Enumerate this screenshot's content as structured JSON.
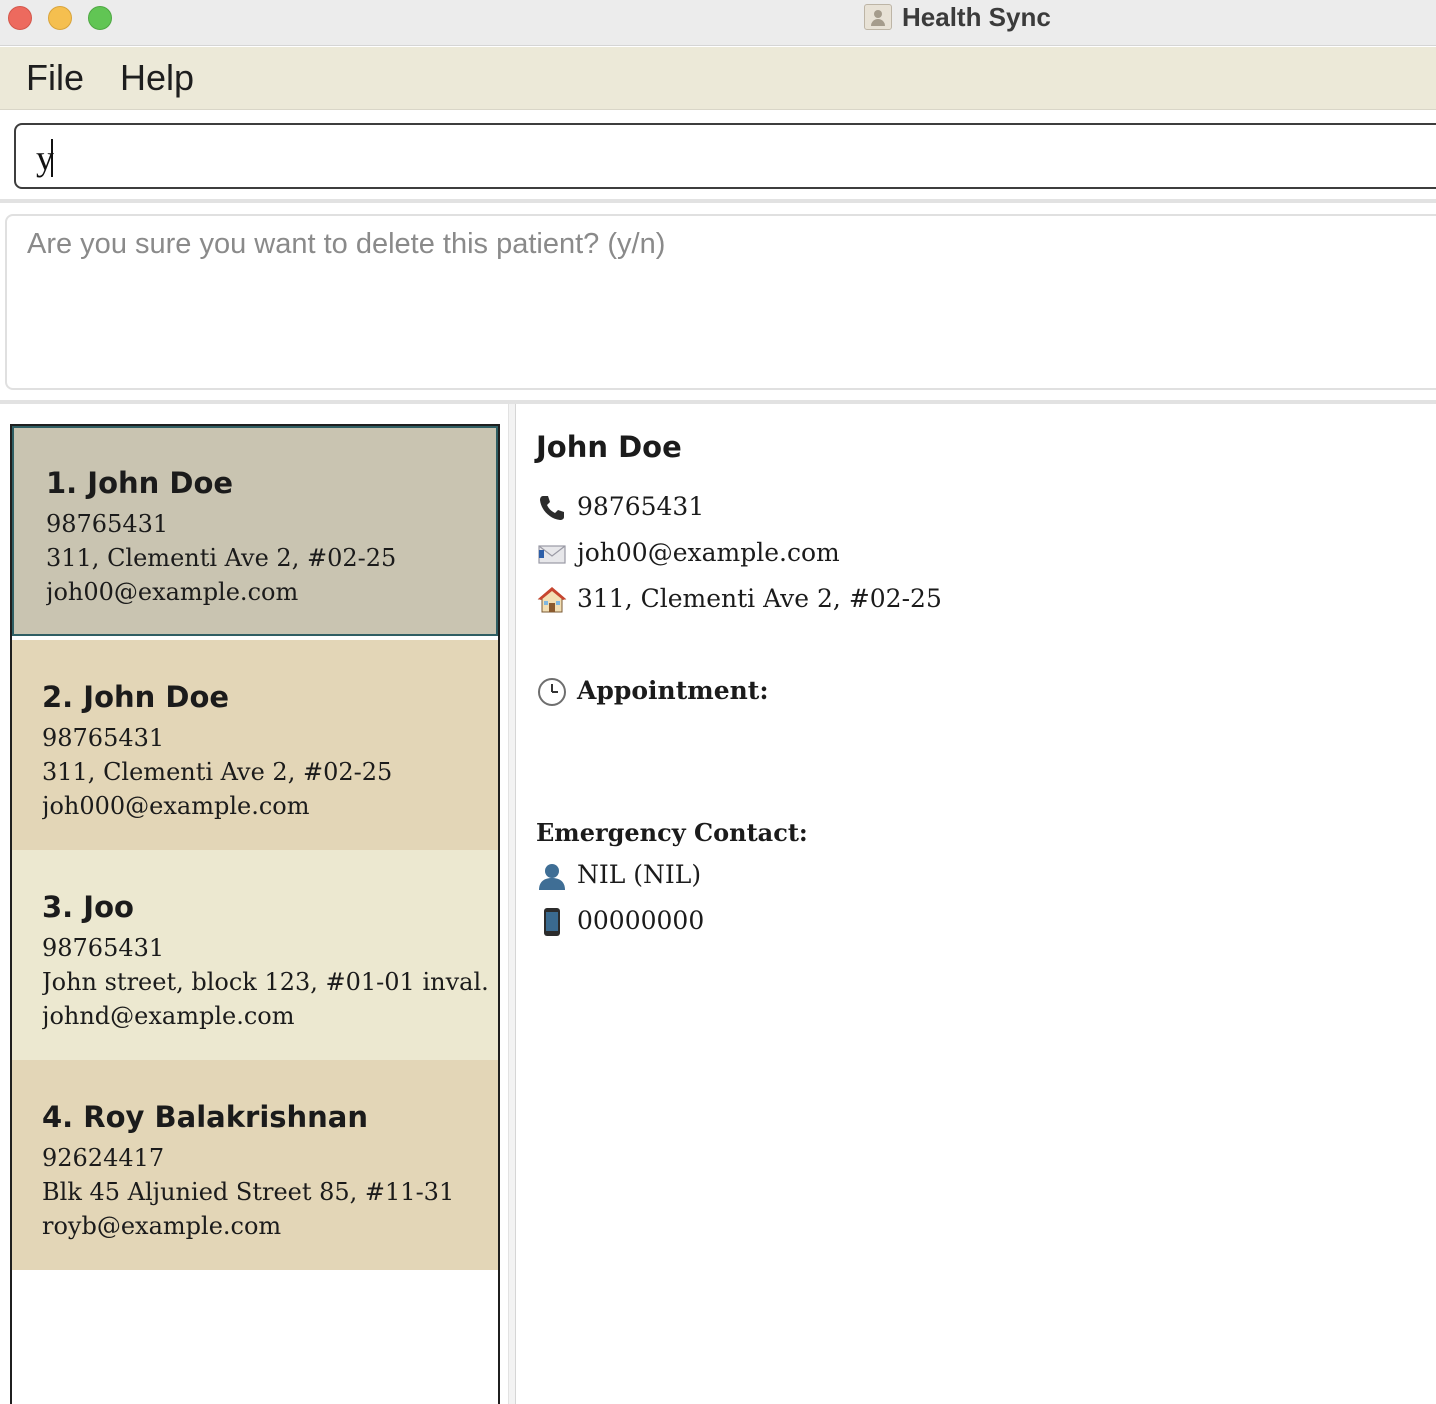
{
  "window": {
    "title": "Health Sync"
  },
  "menu": {
    "file": "File",
    "help": "Help"
  },
  "command": {
    "value": "y"
  },
  "result": {
    "text": "Are you sure you want to delete this patient? (y/n)"
  },
  "patients": [
    {
      "name": "1. John Doe",
      "phone": "98765431",
      "address": "311, Clementi Ave 2, #02-25",
      "email": "joh00@example.com",
      "selected": true
    },
    {
      "name": "2. John Doe",
      "phone": "98765431",
      "address": "311, Clementi Ave 2, #02-25",
      "email": "joh000@example.com"
    },
    {
      "name": "3. Joo",
      "phone": "98765431",
      "address": "John street, block 123, #01-01 inval...",
      "email": "johnd@example.com"
    },
    {
      "name": "4. Roy Balakrishnan",
      "phone": "92624417",
      "address": "Blk 45 Aljunied Street 85, #11-31",
      "email": "royb@example.com"
    }
  ],
  "detail": {
    "name": "John Doe",
    "phone": "98765431",
    "email": "joh00@example.com",
    "address": "311, Clementi Ave 2, #02-25",
    "appointment_label": "Appointment:",
    "emergency_label": "Emergency Contact:",
    "emergency_name": "NIL  (NIL)",
    "emergency_phone": "00000000"
  },
  "icons": {
    "phone": "phone-icon",
    "email": "email-icon",
    "address": "house-icon",
    "appointment": "clock-icon",
    "contact": "person-icon",
    "mobile": "mobile-phone-icon"
  },
  "colors": {
    "selected_card": "#c9c4b1",
    "card_even": "#e3d6b7",
    "card_odd": "#ece8d0",
    "menubar": "#ece9d8"
  }
}
